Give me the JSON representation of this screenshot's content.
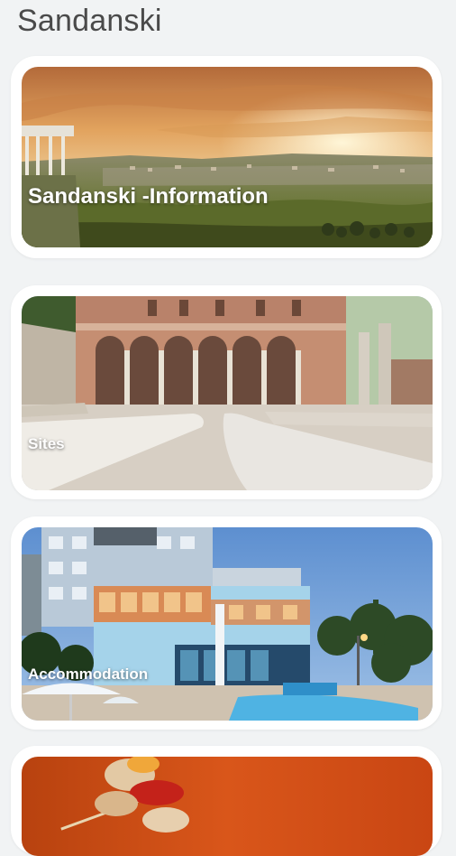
{
  "header": {
    "title": "Sandanski"
  },
  "cards": [
    {
      "label": "Sandanski -Information"
    },
    {
      "label": "Sites"
    },
    {
      "label": "Accommodation"
    },
    {
      "label": ""
    }
  ]
}
